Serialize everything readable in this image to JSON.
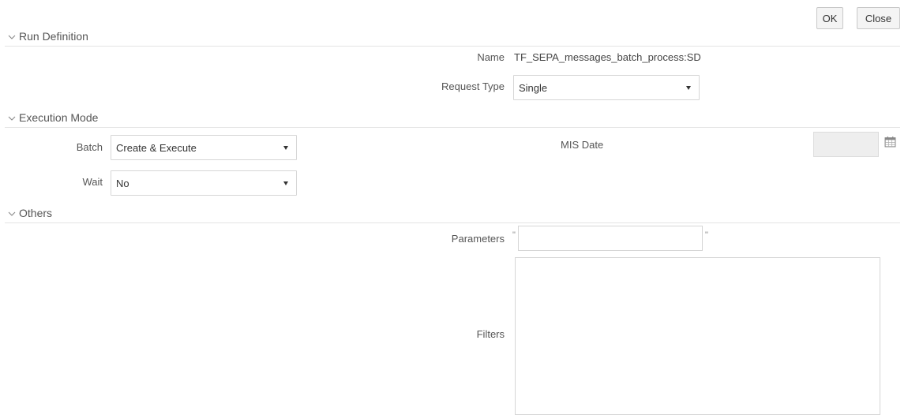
{
  "toolbar": {
    "ok_label": "OK",
    "close_label": "Close"
  },
  "sections": {
    "run_definition": "Run Definition",
    "execution_mode": "Execution Mode",
    "others": "Others"
  },
  "run_definition": {
    "name_label": "Name",
    "name_value": "TF_SEPA_messages_batch_process:SD",
    "request_type_label": "Request Type",
    "request_type_value": "Single"
  },
  "execution_mode": {
    "batch_label": "Batch",
    "batch_value": "Create & Execute",
    "wait_label": "Wait",
    "wait_value": "No",
    "mis_date_label": "MIS Date",
    "mis_date_value": ""
  },
  "others": {
    "parameters_label": "Parameters",
    "parameters_value": "",
    "parameters_quote_open": "\"",
    "parameters_quote_close": "\"",
    "filters_label": "Filters",
    "filters_value": ""
  },
  "icons": {
    "section_toggle": "chevron-down-icon",
    "date_picker": "calendar-icon"
  }
}
